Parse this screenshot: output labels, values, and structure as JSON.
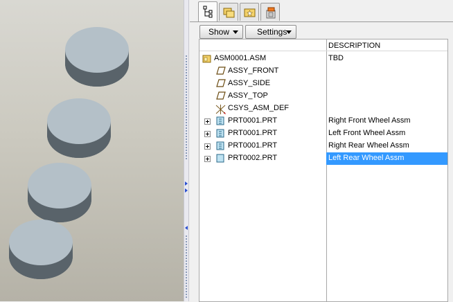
{
  "viewport": {
    "background_top": "#d9d8d2",
    "background_bottom": "#b5b2a7",
    "disc_color": "#b4c0c8",
    "disc_side_color": "#5f6a70"
  },
  "tabs": [
    {
      "icon": "model-tree-icon",
      "active": true
    },
    {
      "icon": "folder-browser-icon",
      "active": false
    },
    {
      "icon": "favorites-icon",
      "active": false
    },
    {
      "icon": "connections-icon",
      "active": false
    }
  ],
  "toolbar": {
    "show_label": "Show",
    "settings_label": "Settings"
  },
  "tree": {
    "column_header": "DESCRIPTION",
    "rows": [
      {
        "name": "ASM0001.ASM",
        "description": "TBD",
        "icon": "assembly-icon"
      },
      {
        "name": "ASSY_FRONT",
        "description": "",
        "icon": "datum-plane-icon"
      },
      {
        "name": "ASSY_SIDE",
        "description": "",
        "icon": "datum-plane-icon"
      },
      {
        "name": "ASSY_TOP",
        "description": "",
        "icon": "datum-plane-icon"
      },
      {
        "name": "CSYS_ASM_DEF",
        "description": "",
        "icon": "coordinate-system-icon"
      },
      {
        "name": "PRT0001.PRT",
        "description": "Right Front Wheel Assm",
        "icon": "part-icon"
      },
      {
        "name": "PRT0001.PRT",
        "description": "Left Front Wheel Assm",
        "icon": "part-icon"
      },
      {
        "name": "PRT0001.PRT",
        "description": "Right Rear Wheel Assm",
        "icon": "part-icon"
      },
      {
        "name": "PRT0002.PRT",
        "description": "Left Rear Wheel Assm",
        "icon": "part-icon",
        "selected": true
      }
    ]
  },
  "colors": {
    "selection": "#3399ff",
    "accent": "#2a4fd0"
  }
}
